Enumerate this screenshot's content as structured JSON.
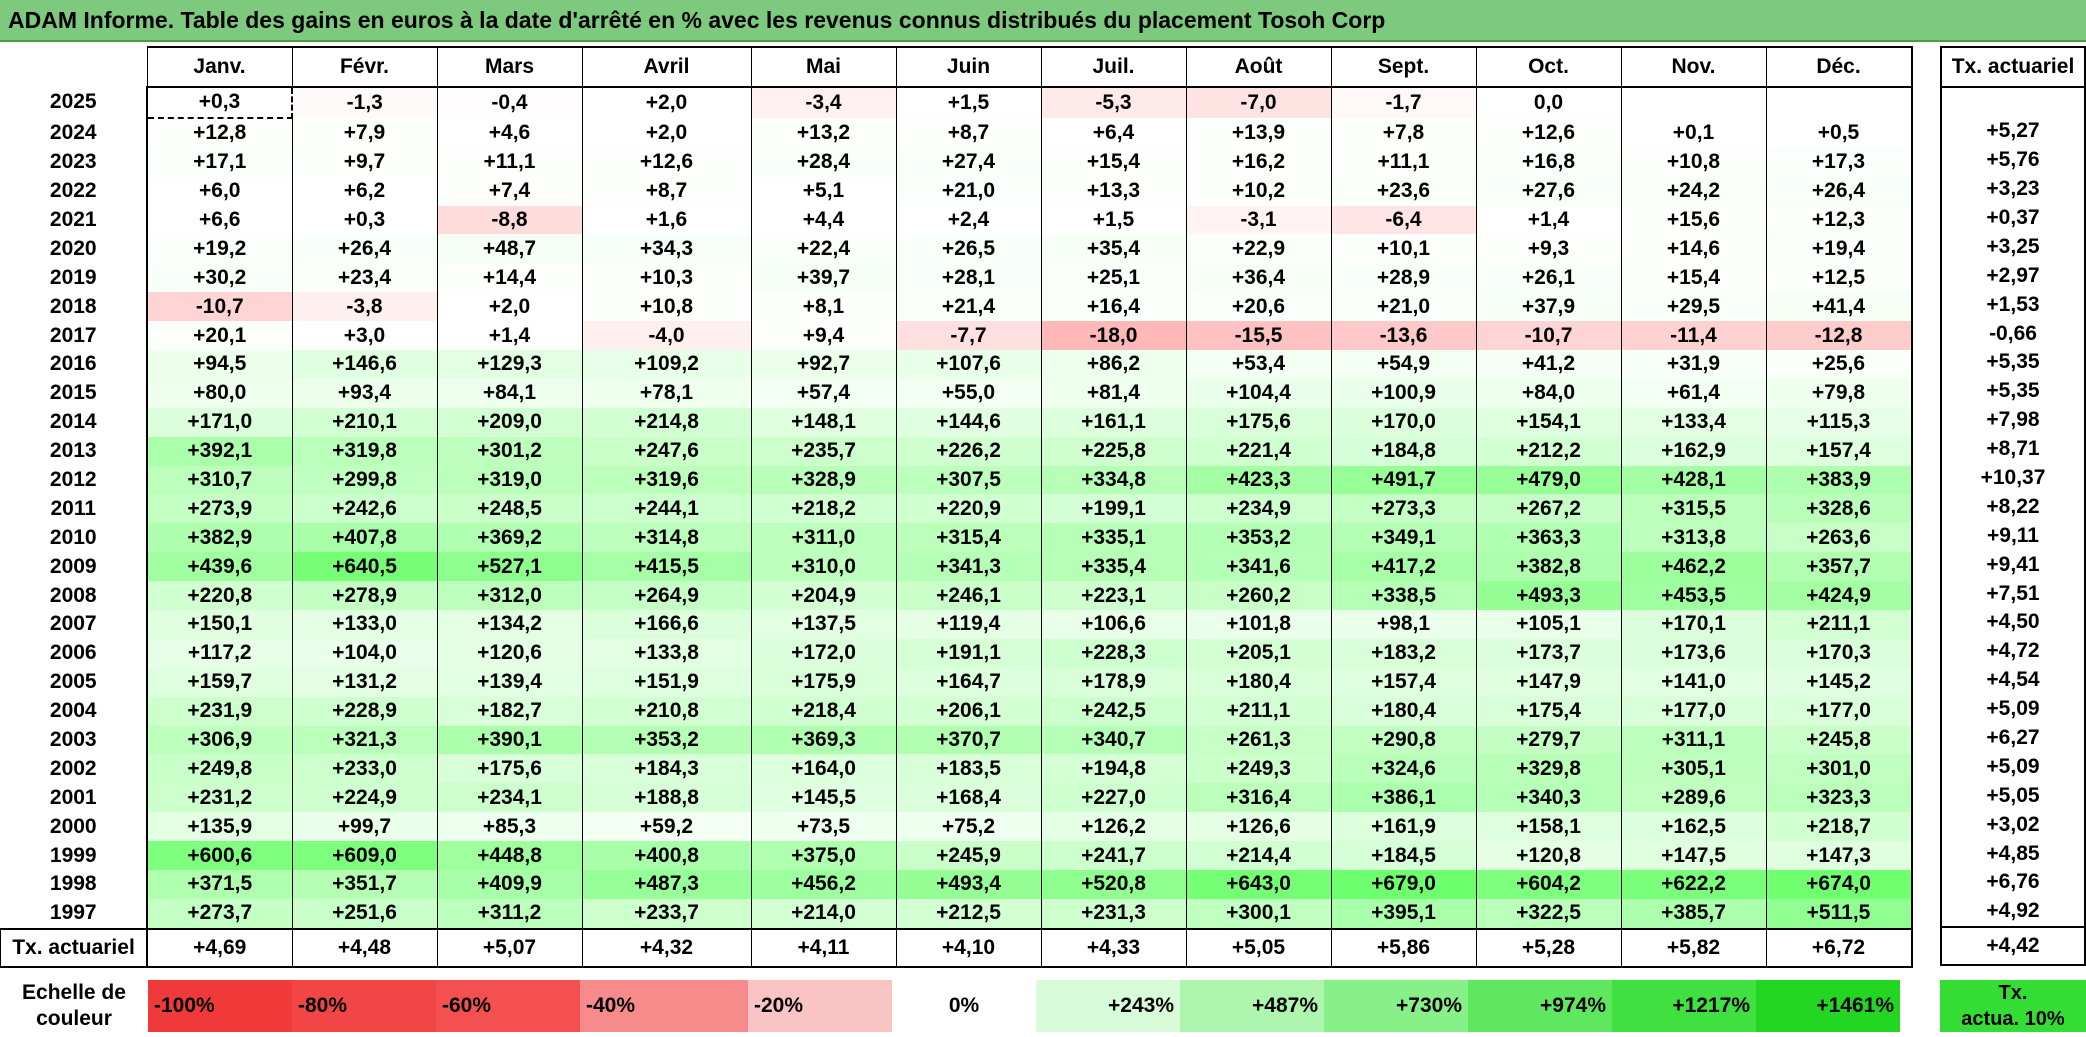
{
  "title": "ADAM Informe. Table des gains en euros à la date d'arrêté en % avec les revenus connus distribués du placement Tosoh Corp",
  "months": [
    "Janv.",
    "Févr.",
    "Mars",
    "Avril",
    "Mai",
    "Juin",
    "Juil.",
    "Août",
    "Sept.",
    "Oct.",
    "Nov.",
    "Déc."
  ],
  "tx_header": "Tx. actuariel",
  "rows": [
    {
      "year": "2025",
      "values": [
        "+0,3",
        "-1,3",
        "-0,4",
        "+2,0",
        "-3,4",
        "+1,5",
        "-5,3",
        "-7,0",
        "-1,7",
        "0,0",
        "",
        ""
      ],
      "tx": ""
    },
    {
      "year": "2024",
      "values": [
        "+12,8",
        "+7,9",
        "+4,6",
        "+2,0",
        "+13,2",
        "+8,7",
        "+6,4",
        "+13,9",
        "+7,8",
        "+12,6",
        "+0,1",
        "+0,5"
      ],
      "tx": "+5,27"
    },
    {
      "year": "2023",
      "values": [
        "+17,1",
        "+9,7",
        "+11,1",
        "+12,6",
        "+28,4",
        "+27,4",
        "+15,4",
        "+16,2",
        "+11,1",
        "+16,8",
        "+10,8",
        "+17,3"
      ],
      "tx": "+5,76"
    },
    {
      "year": "2022",
      "values": [
        "+6,0",
        "+6,2",
        "+7,4",
        "+8,7",
        "+5,1",
        "+21,0",
        "+13,3",
        "+10,2",
        "+23,6",
        "+27,6",
        "+24,2",
        "+26,4"
      ],
      "tx": "+3,23"
    },
    {
      "year": "2021",
      "values": [
        "+6,6",
        "+0,3",
        "-8,8",
        "+1,6",
        "+4,4",
        "+2,4",
        "+1,5",
        "-3,1",
        "-6,4",
        "+1,4",
        "+15,6",
        "+12,3"
      ],
      "tx": "+0,37"
    },
    {
      "year": "2020",
      "values": [
        "+19,2",
        "+26,4",
        "+48,7",
        "+34,3",
        "+22,4",
        "+26,5",
        "+35,4",
        "+22,9",
        "+10,1",
        "+9,3",
        "+14,6",
        "+19,4"
      ],
      "tx": "+3,25"
    },
    {
      "year": "2019",
      "values": [
        "+30,2",
        "+23,4",
        "+14,4",
        "+10,3",
        "+39,7",
        "+28,1",
        "+25,1",
        "+36,4",
        "+28,9",
        "+26,1",
        "+15,4",
        "+12,5"
      ],
      "tx": "+2,97"
    },
    {
      "year": "2018",
      "values": [
        "-10,7",
        "-3,8",
        "+2,0",
        "+10,8",
        "+8,1",
        "+21,4",
        "+16,4",
        "+20,6",
        "+21,0",
        "+37,9",
        "+29,5",
        "+41,4"
      ],
      "tx": "+1,53"
    },
    {
      "year": "2017",
      "values": [
        "+20,1",
        "+3,0",
        "+1,4",
        "-4,0",
        "+9,4",
        "-7,7",
        "-18,0",
        "-15,5",
        "-13,6",
        "-10,7",
        "-11,4",
        "-12,8"
      ],
      "tx": "-0,66"
    },
    {
      "year": "2016",
      "values": [
        "+94,5",
        "+146,6",
        "+129,3",
        "+109,2",
        "+92,7",
        "+107,6",
        "+86,2",
        "+53,4",
        "+54,9",
        "+41,2",
        "+31,9",
        "+25,6"
      ],
      "tx": "+5,35"
    },
    {
      "year": "2015",
      "values": [
        "+80,0",
        "+93,4",
        "+84,1",
        "+78,1",
        "+57,4",
        "+55,0",
        "+81,4",
        "+104,4",
        "+100,9",
        "+84,0",
        "+61,4",
        "+79,8"
      ],
      "tx": "+5,35"
    },
    {
      "year": "2014",
      "values": [
        "+171,0",
        "+210,1",
        "+209,0",
        "+214,8",
        "+148,1",
        "+144,6",
        "+161,1",
        "+175,6",
        "+170,0",
        "+154,1",
        "+133,4",
        "+115,3"
      ],
      "tx": "+7,98"
    },
    {
      "year": "2013",
      "values": [
        "+392,1",
        "+319,8",
        "+301,2",
        "+247,6",
        "+235,7",
        "+226,2",
        "+225,8",
        "+221,4",
        "+184,8",
        "+212,2",
        "+162,9",
        "+157,4"
      ],
      "tx": "+8,71"
    },
    {
      "year": "2012",
      "values": [
        "+310,7",
        "+299,8",
        "+319,0",
        "+319,6",
        "+328,9",
        "+307,5",
        "+334,8",
        "+423,3",
        "+491,7",
        "+479,0",
        "+428,1",
        "+383,9"
      ],
      "tx": "+10,37"
    },
    {
      "year": "2011",
      "values": [
        "+273,9",
        "+242,6",
        "+248,5",
        "+244,1",
        "+218,2",
        "+220,9",
        "+199,1",
        "+234,9",
        "+273,3",
        "+267,2",
        "+315,5",
        "+328,6"
      ],
      "tx": "+8,22"
    },
    {
      "year": "2010",
      "values": [
        "+382,9",
        "+407,8",
        "+369,2",
        "+314,8",
        "+311,0",
        "+315,4",
        "+335,1",
        "+353,2",
        "+349,1",
        "+363,3",
        "+313,8",
        "+263,6"
      ],
      "tx": "+9,11"
    },
    {
      "year": "2009",
      "values": [
        "+439,6",
        "+640,5",
        "+527,1",
        "+415,5",
        "+310,0",
        "+341,3",
        "+335,4",
        "+341,6",
        "+417,2",
        "+382,8",
        "+462,2",
        "+357,7"
      ],
      "tx": "+9,41"
    },
    {
      "year": "2008",
      "values": [
        "+220,8",
        "+278,9",
        "+312,0",
        "+264,9",
        "+204,9",
        "+246,1",
        "+223,1",
        "+260,2",
        "+338,5",
        "+493,3",
        "+453,5",
        "+424,9"
      ],
      "tx": "+7,51"
    },
    {
      "year": "2007",
      "values": [
        "+150,1",
        "+133,0",
        "+134,2",
        "+166,6",
        "+137,5",
        "+119,4",
        "+106,6",
        "+101,8",
        "+98,1",
        "+105,1",
        "+170,1",
        "+211,1"
      ],
      "tx": "+4,50"
    },
    {
      "year": "2006",
      "values": [
        "+117,2",
        "+104,0",
        "+120,6",
        "+133,8",
        "+172,0",
        "+191,1",
        "+228,3",
        "+205,1",
        "+183,2",
        "+173,7",
        "+173,6",
        "+170,3"
      ],
      "tx": "+4,72"
    },
    {
      "year": "2005",
      "values": [
        "+159,7",
        "+131,2",
        "+139,4",
        "+151,9",
        "+175,9",
        "+164,7",
        "+178,9",
        "+180,4",
        "+157,4",
        "+147,9",
        "+141,0",
        "+145,2"
      ],
      "tx": "+4,54"
    },
    {
      "year": "2004",
      "values": [
        "+231,9",
        "+228,9",
        "+182,7",
        "+210,8",
        "+218,4",
        "+206,1",
        "+242,5",
        "+211,1",
        "+180,4",
        "+175,4",
        "+177,0",
        "+177,0"
      ],
      "tx": "+5,09"
    },
    {
      "year": "2003",
      "values": [
        "+306,9",
        "+321,3",
        "+390,1",
        "+353,2",
        "+369,3",
        "+370,7",
        "+340,7",
        "+261,3",
        "+290,8",
        "+279,7",
        "+311,1",
        "+245,8"
      ],
      "tx": "+6,27"
    },
    {
      "year": "2002",
      "values": [
        "+249,8",
        "+233,0",
        "+175,6",
        "+184,3",
        "+164,0",
        "+183,5",
        "+194,8",
        "+249,3",
        "+324,6",
        "+329,8",
        "+305,1",
        "+301,0"
      ],
      "tx": "+5,09"
    },
    {
      "year": "2001",
      "values": [
        "+231,2",
        "+224,9",
        "+234,1",
        "+188,8",
        "+145,5",
        "+168,4",
        "+227,0",
        "+316,4",
        "+386,1",
        "+340,3",
        "+289,6",
        "+323,3"
      ],
      "tx": "+5,05"
    },
    {
      "year": "2000",
      "values": [
        "+135,9",
        "+99,7",
        "+85,3",
        "+59,2",
        "+73,5",
        "+75,2",
        "+126,2",
        "+126,6",
        "+161,9",
        "+158,1",
        "+162,5",
        "+218,7"
      ],
      "tx": "+3,02"
    },
    {
      "year": "1999",
      "values": [
        "+600,6",
        "+609,0",
        "+448,8",
        "+400,8",
        "+375,0",
        "+245,9",
        "+241,7",
        "+214,4",
        "+184,5",
        "+120,8",
        "+147,5",
        "+147,3"
      ],
      "tx": "+4,85"
    },
    {
      "year": "1998",
      "values": [
        "+371,5",
        "+351,7",
        "+409,9",
        "+487,3",
        "+456,2",
        "+493,4",
        "+520,8",
        "+643,0",
        "+679,0",
        "+604,2",
        "+622,2",
        "+674,0"
      ],
      "tx": "+6,76"
    },
    {
      "year": "1997",
      "values": [
        "+273,7",
        "+251,6",
        "+311,2",
        "+233,7",
        "+214,0",
        "+212,5",
        "+231,3",
        "+300,1",
        "+395,1",
        "+322,5",
        "+385,7",
        "+511,5"
      ],
      "tx": "+4,92"
    }
  ],
  "tx_row": {
    "label": "Tx. actuariel",
    "values": [
      "+4,69",
      "+4,48",
      "+5,07",
      "+4,32",
      "+4,11",
      "+4,10",
      "+4,33",
      "+5,05",
      "+5,86",
      "+5,28",
      "+5,82",
      "+6,72"
    ],
    "total": "+4,42"
  },
  "scale": {
    "label_line1": "Echelle de",
    "label_line2": "couleur",
    "items": [
      {
        "text": "-100%",
        "color": "#f03a3a"
      },
      {
        "text": "-80%",
        "color": "#f24646"
      },
      {
        "text": "-60%",
        "color": "#f45050"
      },
      {
        "text": "-40%",
        "color": "#f78a8a"
      },
      {
        "text": "-20%",
        "color": "#fbc4c4"
      },
      {
        "text": "0%",
        "color": "#ffffff"
      },
      {
        "text": "+243%",
        "color": "#d8fbd8"
      },
      {
        "text": "+487%",
        "color": "#aef5ae"
      },
      {
        "text": "+730%",
        "color": "#88f088"
      },
      {
        "text": "+974%",
        "color": "#5fe85f"
      },
      {
        "text": "+1217%",
        "color": "#3fe03f"
      },
      {
        "text": "+1461%",
        "color": "#22d622"
      }
    ],
    "tx_line1": "Tx.",
    "tx_line2": "actua. 10%"
  }
}
